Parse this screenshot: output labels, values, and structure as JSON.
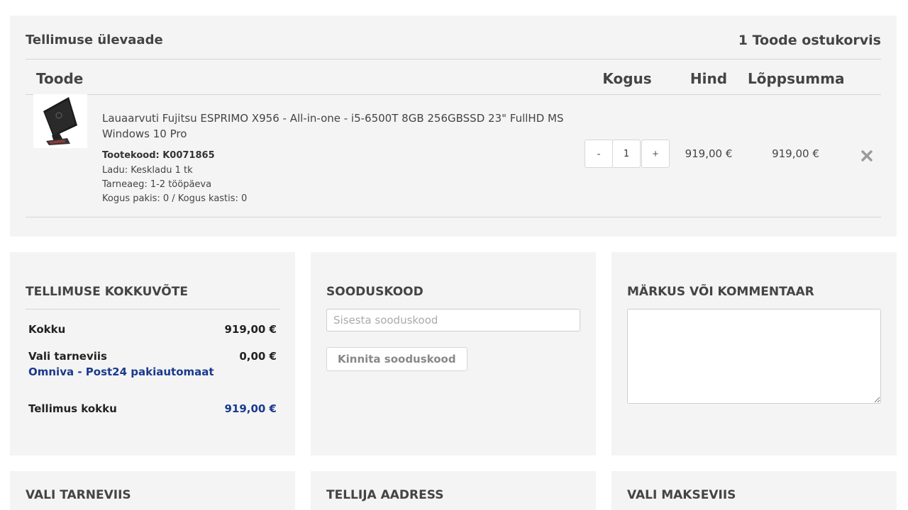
{
  "overview": {
    "title": "Tellimuse ülevaade",
    "count_label": "1 Toode ostukorvis",
    "columns": {
      "product": "Toode",
      "quantity": "Kogus",
      "price": "Hind",
      "total": "Lõppsumma"
    }
  },
  "item": {
    "name": "Lauaarvuti Fujitsu ESPRIMO X956 - All-in-one - i5-6500T 8GB 256GBSSD 23\" FullHD MS Windows 10 Pro",
    "code": "Tootekood: K0071865",
    "stock": "Ladu: Keskladu 1 tk",
    "delivery": "Tarneaeg: 1-2 tööpäeva",
    "pack": "Kogus pakis: 0 / Kogus kastis: 0",
    "qty_minus": "-",
    "qty_plus": "+",
    "quantity": "1",
    "price": "919,00 €",
    "total": "919,00 €"
  },
  "summary": {
    "title": "TELLIMUSE KOKKUVÕTE",
    "subtotal_label": "Kokku",
    "subtotal_value": "919,00 €",
    "shipping_label": "Vali tarneviis",
    "shipping_value": "0,00 €",
    "shipping_method": "Omniva - Post24 pakiautomaat",
    "total_label": "Tellimus kokku",
    "total_value": "919,00 €"
  },
  "coupon": {
    "title": "SOODUSKOOD",
    "placeholder": "Sisesta sooduskood",
    "button": "Kinnita sooduskood"
  },
  "comment": {
    "title": "MÄRKUS VÕI KOMMENTAAR"
  },
  "bottom": {
    "shipping_title": "VALI TARNEVIIS",
    "address_title": "TELLIJA AADRESS",
    "payment_title": "VALI MAKSEVIIS"
  },
  "colors": {
    "panel_bg": "#f4f4f4",
    "link_blue": "#1a3a8c",
    "divider": "#d4d4d4"
  },
  "icons": {
    "remove": "close-x-icon",
    "product_image": "all-in-one-pc-icon"
  }
}
